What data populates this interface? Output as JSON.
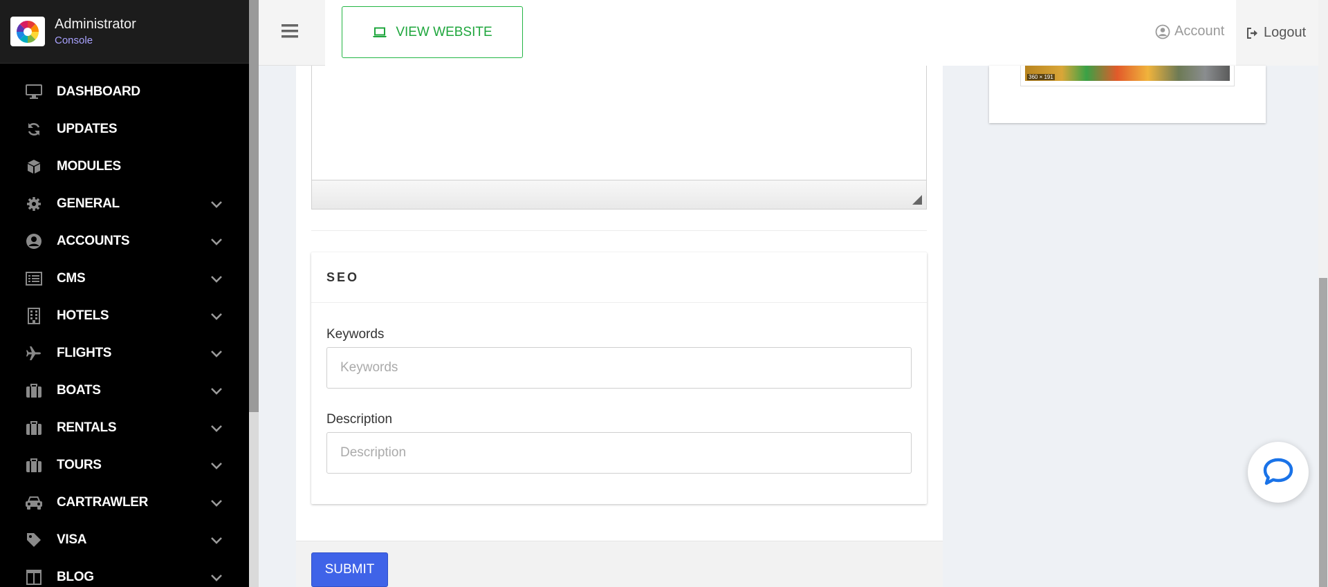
{
  "brand": {
    "title": "Administrator",
    "subtitle": "Console"
  },
  "sidebar": {
    "items": [
      {
        "label": "DASHBOARD",
        "icon": "monitor-icon",
        "expandable": false
      },
      {
        "label": "UPDATES",
        "icon": "refresh-icon",
        "expandable": false
      },
      {
        "label": "MODULES",
        "icon": "cube-icon",
        "expandable": false
      },
      {
        "label": "GENERAL",
        "icon": "gear-icon",
        "expandable": true
      },
      {
        "label": "ACCOUNTS",
        "icon": "user-circle-icon",
        "expandable": true
      },
      {
        "label": "CMS",
        "icon": "list-icon",
        "expandable": true
      },
      {
        "label": "HOTELS",
        "icon": "building-icon",
        "expandable": true
      },
      {
        "label": "FLIGHTS",
        "icon": "plane-icon",
        "expandable": true
      },
      {
        "label": "BOATS",
        "icon": "suitcase-icon",
        "expandable": true
      },
      {
        "label": "RENTALS",
        "icon": "suitcase-icon",
        "expandable": true
      },
      {
        "label": "TOURS",
        "icon": "suitcase-icon",
        "expandable": true
      },
      {
        "label": "CARTRAWLER",
        "icon": "car-icon",
        "expandable": true
      },
      {
        "label": "VISA",
        "icon": "tag-icon",
        "expandable": true
      },
      {
        "label": "BLOG",
        "icon": "columns-icon",
        "expandable": true
      }
    ]
  },
  "header": {
    "view_website_label": "VIEW WEBSITE",
    "account_label": "Account",
    "logout_label": "Logout"
  },
  "thumbnail": {
    "caption": "360 × 191"
  },
  "seo": {
    "title": "SEO",
    "keywords_label": "Keywords",
    "keywords_placeholder": "Keywords",
    "keywords_value": "",
    "description_label": "Description",
    "description_placeholder": "Description",
    "description_value": ""
  },
  "form": {
    "submit_label": "SUBMIT"
  },
  "colors": {
    "sidebar_bg": "#000000",
    "accent_green": "#22b543",
    "submit_blue": "#3f63e8",
    "chat_blue": "#1a73e8"
  }
}
